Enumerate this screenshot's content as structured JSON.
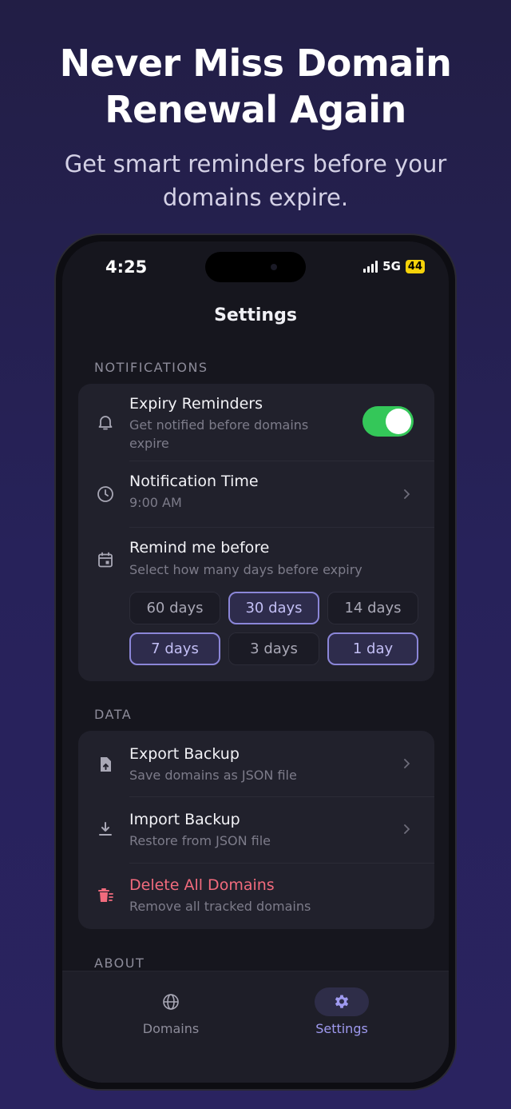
{
  "promo": {
    "headline_line1": "Never Miss Domain",
    "headline_line2": "Renewal Again",
    "subhead_line1": "Get smart reminders before your",
    "subhead_line2": "domains expire."
  },
  "status_bar": {
    "time": "4:25",
    "network": "5G",
    "battery": "44"
  },
  "page": {
    "title": "Settings"
  },
  "notifications": {
    "section_label": "NOTIFICATIONS",
    "expiry_reminders": {
      "title": "Expiry Reminders",
      "subtitle_line1": "Get notified before domains",
      "subtitle_line2": "expire",
      "enabled": true
    },
    "notification_time": {
      "title": "Notification Time",
      "value": "9:00 AM"
    },
    "remind_before": {
      "title": "Remind me before",
      "subtitle": "Select how many days before expiry",
      "options": [
        {
          "label": "60 days",
          "selected": false
        },
        {
          "label": "30 days",
          "selected": true
        },
        {
          "label": "14 days",
          "selected": false
        },
        {
          "label": "7 days",
          "selected": true
        },
        {
          "label": "3 days",
          "selected": false
        },
        {
          "label": "1 day",
          "selected": true
        }
      ]
    }
  },
  "data": {
    "section_label": "DATA",
    "export": {
      "title": "Export Backup",
      "subtitle": "Save domains as JSON file"
    },
    "import": {
      "title": "Import Backup",
      "subtitle": "Restore from JSON file"
    },
    "delete": {
      "title": "Delete All Domains",
      "subtitle": "Remove all tracked domains"
    }
  },
  "about": {
    "section_label": "ABOUT"
  },
  "tabs": [
    {
      "label": "Domains",
      "icon": "globe-icon",
      "active": false
    },
    {
      "label": "Settings",
      "icon": "gear-icon",
      "active": true
    }
  ],
  "colors": {
    "accent": "#9f9af0",
    "toggle_on": "#34c759",
    "danger": "#f26b7d",
    "battery": "#f5d20a"
  }
}
